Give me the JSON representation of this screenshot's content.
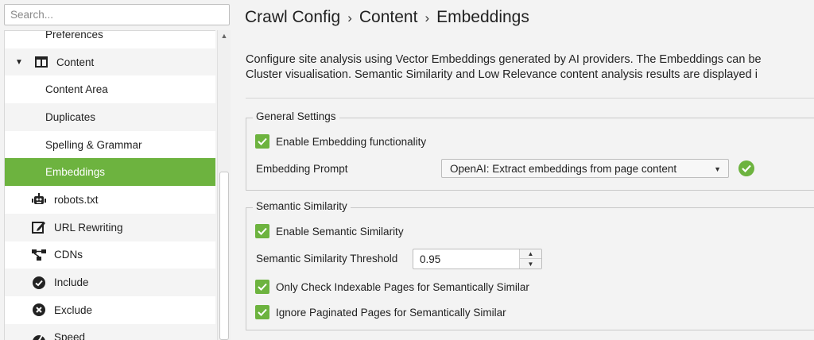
{
  "search": {
    "placeholder": "Search..."
  },
  "tree": {
    "partial_item": "Preferences",
    "content_label": "Content",
    "sub_items": [
      {
        "label": "Content Area"
      },
      {
        "label": "Duplicates"
      },
      {
        "label": "Spelling & Grammar"
      },
      {
        "label": "Embeddings",
        "selected": true
      }
    ],
    "items": [
      {
        "label": "robots.txt",
        "icon": "robot-icon"
      },
      {
        "label": "URL Rewriting",
        "icon": "edit-icon"
      },
      {
        "label": "CDNs",
        "icon": "network-icon"
      },
      {
        "label": "Include",
        "icon": "check-circle-icon"
      },
      {
        "label": "Exclude",
        "icon": "x-circle-icon"
      },
      {
        "label": "Speed",
        "icon": "speedometer-icon"
      }
    ]
  },
  "breadcrumb": {
    "part1": "Crawl Config",
    "part2": "Content",
    "part3": "Embeddings",
    "separator": "›"
  },
  "description": {
    "line1": "Configure site analysis using Vector Embeddings generated by AI providers. The Embeddings can be",
    "line2": "Cluster visualisation. Semantic Similarity and Low Relevance content analysis results are displayed i"
  },
  "general": {
    "title": "General Settings",
    "enable_label": "Enable Embedding functionality",
    "prompt_label": "Embedding Prompt",
    "prompt_value": "OpenAI: Extract embeddings from page content"
  },
  "semantic": {
    "title": "Semantic Similarity",
    "enable_label": "Enable Semantic Similarity",
    "threshold_label": "Semantic Similarity Threshold",
    "threshold_value": "0.95",
    "indexable_label": "Only Check Indexable Pages for Semantically Similar",
    "paginated_label": "Ignore Paginated Pages for Semantically Similar"
  },
  "colors": {
    "accent": "#6db33f"
  }
}
